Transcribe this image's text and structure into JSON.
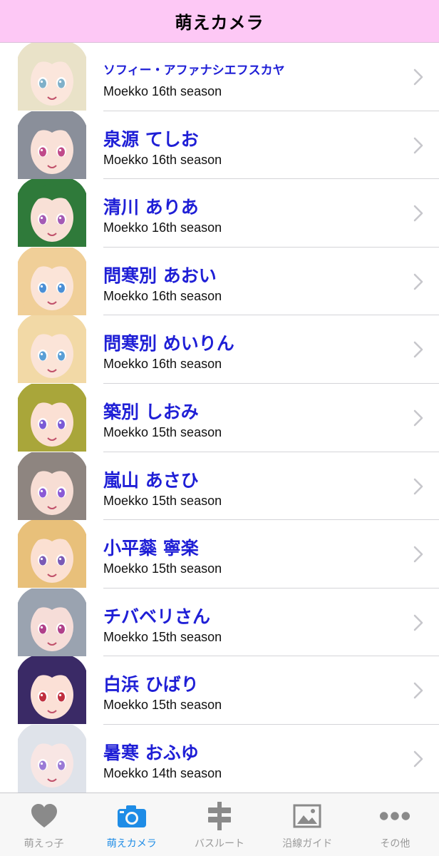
{
  "nav": {
    "title": "萌えカメラ"
  },
  "characters": [
    {
      "name": "ソフィー・アファナシエフスカヤ",
      "season": "Moekko 16th season"
    },
    {
      "name": "泉源 てしお",
      "season": "Moekko 16th season"
    },
    {
      "name": "清川 ありあ",
      "season": "Moekko 16th season"
    },
    {
      "name": "問寒別 あおい",
      "season": "Moekko 16th season"
    },
    {
      "name": "問寒別 めいりん",
      "season": "Moekko 16th season"
    },
    {
      "name": "築別 しおみ",
      "season": "Moekko 15th season"
    },
    {
      "name": "嵐山 あさひ",
      "season": "Moekko 15th season"
    },
    {
      "name": "小平蘂 寧楽",
      "season": "Moekko 15th season"
    },
    {
      "name": "チバベリさん",
      "season": "Moekko 15th season"
    },
    {
      "name": "白浜 ひばり",
      "season": "Moekko 15th season"
    },
    {
      "name": "暑寒 おふゆ",
      "season": "Moekko 14th season"
    }
  ],
  "tabs": [
    {
      "label": "萌えっ子",
      "icon": "heart-icon",
      "active": false
    },
    {
      "label": "萌えカメラ",
      "icon": "camera-icon",
      "active": true
    },
    {
      "label": "バスルート",
      "icon": "bus-stop-sign-icon",
      "active": false
    },
    {
      "label": "沿線ガイド",
      "icon": "picture-icon",
      "active": false
    },
    {
      "label": "その他",
      "icon": "more-dots-icon",
      "active": false
    }
  ],
  "colors": {
    "nav_background": "#fdc8f5",
    "name_text": "#1f1fd6",
    "tab_active": "#1e8ce6",
    "tab_inactive": "#9a9a9a"
  }
}
